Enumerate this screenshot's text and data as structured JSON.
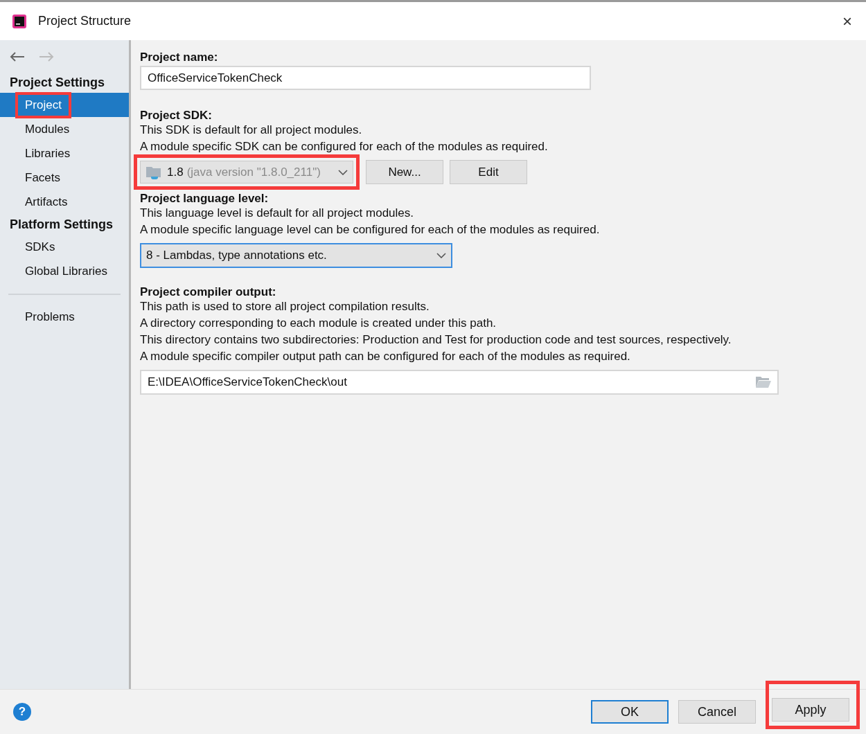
{
  "window": {
    "title": "Project Structure",
    "close": "×"
  },
  "sidebar": {
    "groups": [
      {
        "heading": "Project Settings",
        "items": [
          {
            "label": "Project",
            "selected": true,
            "annotated": true
          },
          {
            "label": "Modules",
            "selected": false,
            "annotated": false
          },
          {
            "label": "Libraries",
            "selected": false,
            "annotated": false
          },
          {
            "label": "Facets",
            "selected": false,
            "annotated": false
          },
          {
            "label": "Artifacts",
            "selected": false,
            "annotated": false
          }
        ]
      },
      {
        "heading": "Platform Settings",
        "items": [
          {
            "label": "SDKs",
            "selected": false,
            "annotated": false
          },
          {
            "label": "Global Libraries",
            "selected": false,
            "annotated": false
          }
        ]
      }
    ],
    "extra_items": [
      {
        "label": "Problems",
        "selected": false,
        "annotated": false
      }
    ]
  },
  "project_name": {
    "label": "Project name:",
    "value": "OfficeServiceTokenCheck"
  },
  "project_sdk": {
    "label": "Project SDK:",
    "lines": [
      "This SDK is default for all project modules.",
      "A module specific SDK can be configured for each of the modules as required."
    ],
    "version": "1.8",
    "detail": "(java version \"1.8.0_211\")",
    "annotated": true,
    "buttons": [
      "New...",
      "Edit"
    ]
  },
  "language_level": {
    "label": "Project language level:",
    "lines": [
      "This language level is default for all project modules.",
      "A module specific language level can be configured for each of the modules as required."
    ],
    "value": "8 - Lambdas, type annotations etc."
  },
  "compiler_output": {
    "label": "Project compiler output:",
    "lines": [
      "This path is used to store all project compilation results.",
      "A directory corresponding to each module is created under this path.",
      "This directory contains two subdirectories: Production and Test for production code and test sources, respectively.",
      "A module specific compiler output path can be configured for each of the modules as required."
    ],
    "value": "E:\\IDEA\\OfficeServiceTokenCheck\\out"
  },
  "footer": {
    "help": "?",
    "buttons": [
      {
        "label": "OK",
        "default": true,
        "annotated": false
      },
      {
        "label": "Cancel",
        "default": false,
        "annotated": false
      },
      {
        "label": "Apply",
        "default": false,
        "annotated": true
      }
    ]
  }
}
